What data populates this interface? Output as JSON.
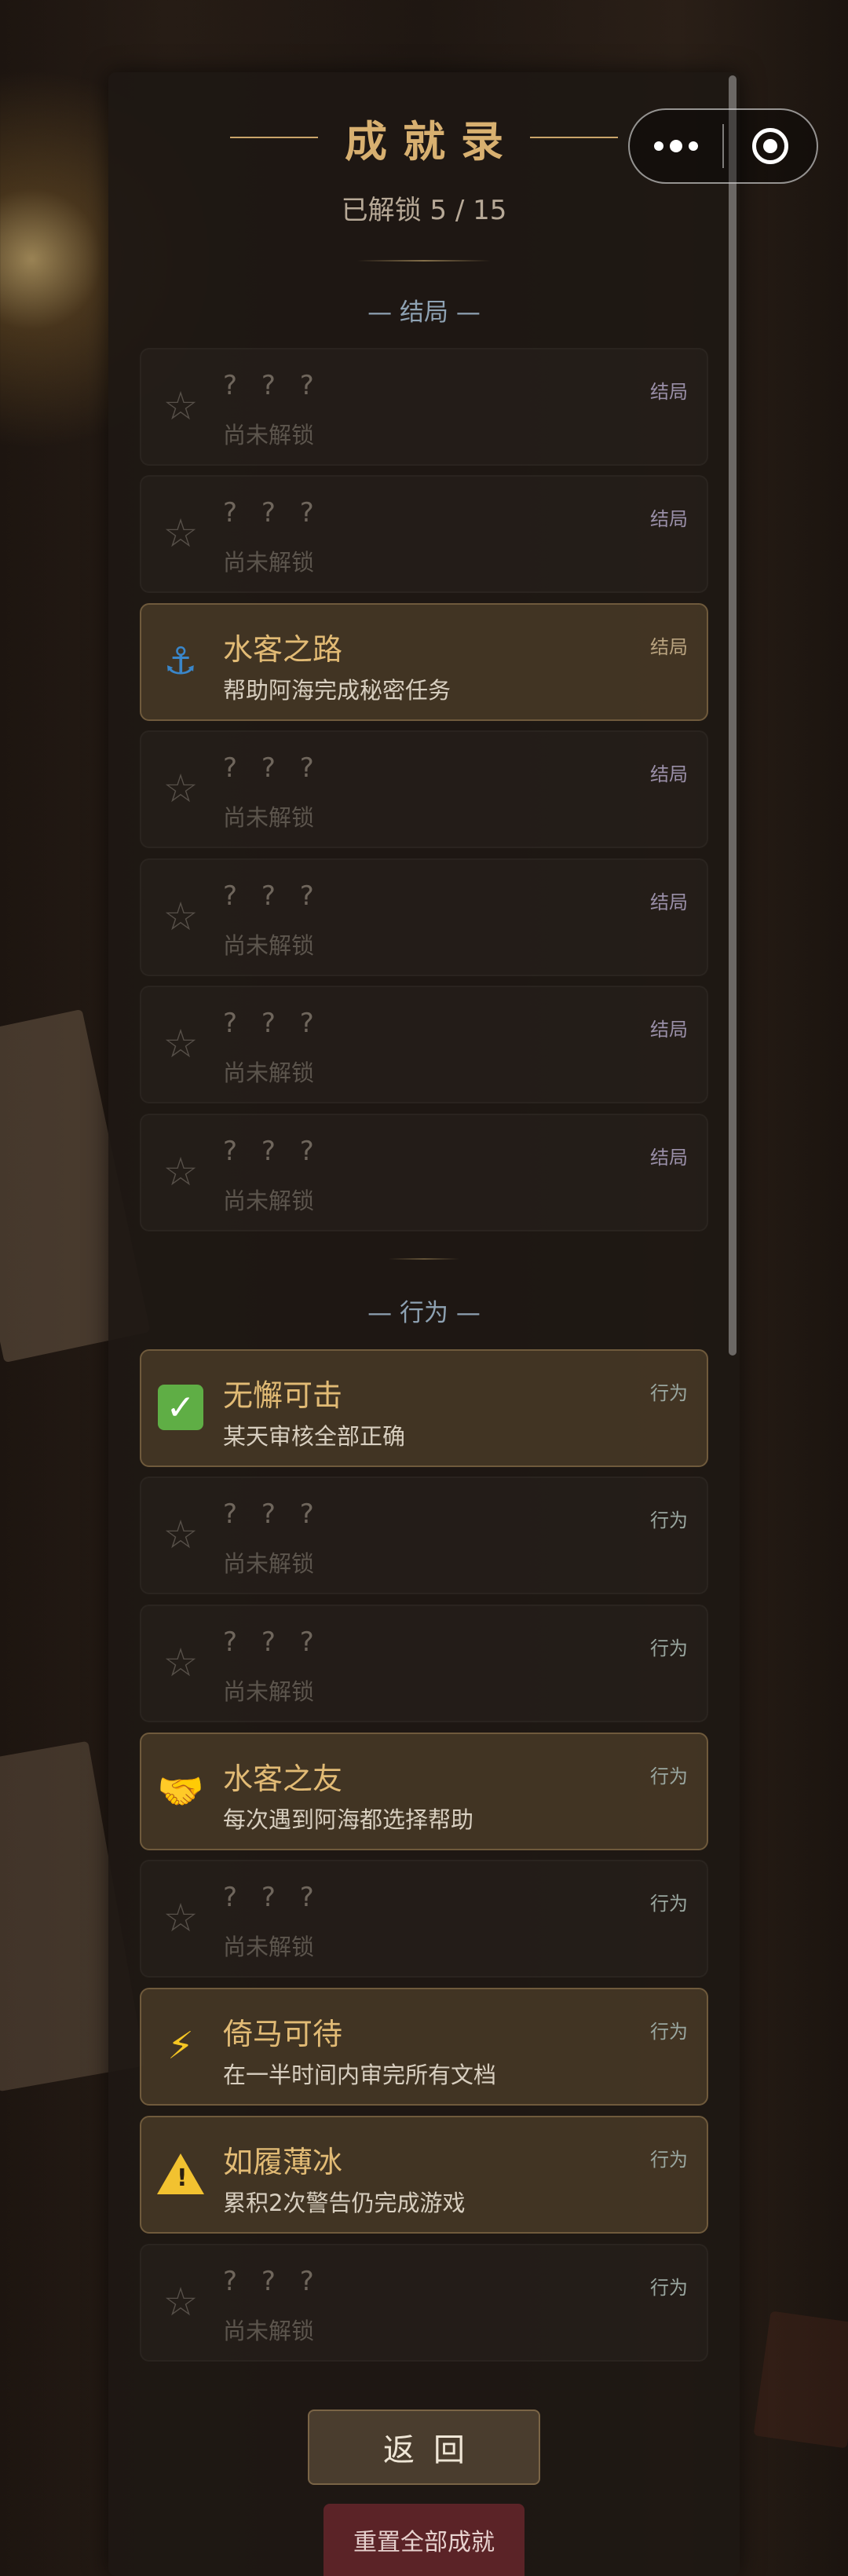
{
  "header": {
    "title": "成就录",
    "progress_text": "已解锁 5 / 15",
    "unlocked_count": 5,
    "total_count": 15
  },
  "capsule": {
    "more_icon": "more-dots-icon",
    "close_icon": "target-circle-icon"
  },
  "sections": {
    "ending": "— 结局 —",
    "behavior": "— 行为 —"
  },
  "achievements": [
    {
      "name": "? ? ?",
      "desc": "尚未解锁",
      "tag": "结局",
      "locked": true,
      "icon": "star-outline-icon"
    },
    {
      "name": "? ? ?",
      "desc": "尚未解锁",
      "tag": "结局",
      "locked": true,
      "icon": "star-outline-icon"
    },
    {
      "name": "水客之路",
      "desc": "帮助阿海完成秘密任务",
      "tag": "结局",
      "locked": false,
      "icon": "anchor-icon"
    },
    {
      "name": "? ? ?",
      "desc": "尚未解锁",
      "tag": "结局",
      "locked": true,
      "icon": "star-outline-icon"
    },
    {
      "name": "? ? ?",
      "desc": "尚未解锁",
      "tag": "结局",
      "locked": true,
      "icon": "star-outline-icon"
    },
    {
      "name": "? ? ?",
      "desc": "尚未解锁",
      "tag": "结局",
      "locked": true,
      "icon": "star-outline-icon"
    },
    {
      "name": "? ? ?",
      "desc": "尚未解锁",
      "tag": "结局",
      "locked": true,
      "icon": "star-outline-icon"
    },
    {
      "name": "无懈可击",
      "desc": "某天审核全部正确",
      "tag": "行为",
      "locked": false,
      "icon": "green-check-icon"
    },
    {
      "name": "? ? ?",
      "desc": "尚未解锁",
      "tag": "行为",
      "locked": true,
      "icon": "star-outline-icon"
    },
    {
      "name": "? ? ?",
      "desc": "尚未解锁",
      "tag": "行为",
      "locked": true,
      "icon": "star-outline-icon"
    },
    {
      "name": "水客之友",
      "desc": "每次遇到阿海都选择帮助",
      "tag": "行为",
      "locked": false,
      "icon": "handshake-icon"
    },
    {
      "name": "? ? ?",
      "desc": "尚未解锁",
      "tag": "行为",
      "locked": true,
      "icon": "star-outline-icon"
    },
    {
      "name": "倚马可待",
      "desc": "在一半时间内审完所有文档",
      "tag": "行为",
      "locked": false,
      "icon": "lightning-icon"
    },
    {
      "name": "如履薄冰",
      "desc": "累积2次警告仍完成游戏",
      "tag": "行为",
      "locked": false,
      "icon": "warning-icon"
    },
    {
      "name": "? ? ?",
      "desc": "尚未解锁",
      "tag": "行为",
      "locked": true,
      "icon": "star-outline-icon"
    }
  ],
  "buttons": {
    "back": "返回",
    "reset": "重置全部成就"
  }
}
